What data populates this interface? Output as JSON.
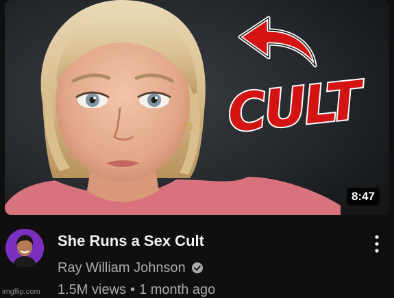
{
  "video": {
    "thumbnail": {
      "overlay_text": "CULT",
      "duration": "8:47",
      "accent_color": "#d41313"
    },
    "title": "She Runs a Sex Cult",
    "channel": {
      "name": "Ray William Johnson",
      "verified_icon": "verified-check-icon"
    },
    "views": "1.5M views",
    "separator": "•",
    "age": "1 month ago",
    "more_icon": "more-vert-icon"
  },
  "watermark": "imgflip.com"
}
